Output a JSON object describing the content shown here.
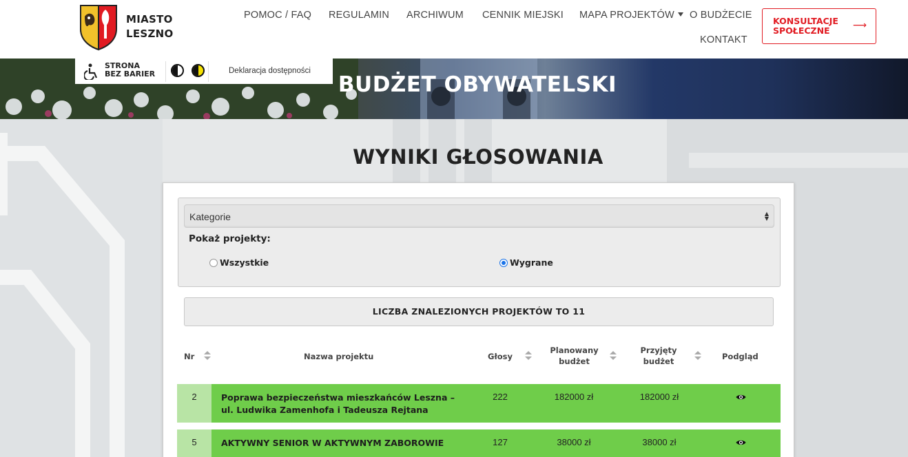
{
  "brand": {
    "name": "MIASTO\nLESZNO"
  },
  "nav": {
    "items": [
      "POMOC / FAQ",
      "REGULAMIN",
      "ARCHIWUM",
      "CENNIK MIEJSKI",
      "MAPA PROJEKTÓW",
      "O BUDŻECIE",
      "KONTAKT"
    ],
    "consult_button": "KONSULTACJE\nSPOŁECZNE"
  },
  "accessibility": {
    "label": "STRONA\nBEZ BARIER",
    "declaration": "Deklaracja dostępności"
  },
  "hero": {
    "title": "BUDŻET OBYWATELSKI"
  },
  "section": {
    "title": "WYNIKI GŁOSOWANIA"
  },
  "filters": {
    "category_select": "Kategorie",
    "show_label": "Pokaż projekty:",
    "radio_all": "Wszystkie",
    "radio_won": "Wygrane",
    "selected": "Wygrane"
  },
  "results": {
    "count_text": "LICZBA ZNALEZIONYCH PROJEKTÓW TO 11"
  },
  "table": {
    "headers": {
      "nr": "Nr",
      "name": "Nazwa projektu",
      "votes": "Głosy",
      "planned": "Planowany\nbudżet",
      "accepted": "Przyjęty\nbudżet",
      "preview": "Podgląd"
    },
    "rows": [
      {
        "nr": "2",
        "name": "Poprawa bezpieczeństwa mieszkańców Leszna – ul. Ludwika Zamenhofa i Tadeusza Rejtana",
        "votes": "222",
        "planned": "182000 zł",
        "accepted": "182000 zł"
      },
      {
        "nr": "5",
        "name": "AKTYWNY SENIOR W AKTYWNYM ZABOROWIE",
        "votes": "127",
        "planned": "38000 zł",
        "accepted": "38000 zł"
      }
    ]
  },
  "colors": {
    "accent_red": "#e11b22",
    "row_green": "#6fcd4a",
    "nr_green": "#b8e4a5",
    "radio_blue": "#1a73e8"
  },
  "icons": [
    "city-crest-icon",
    "wheelchair-icon",
    "contrast-dark-icon",
    "contrast-yellow-icon",
    "arrow-right-icon",
    "chevron-down-icon",
    "sort-icon",
    "eye-icon",
    "select-arrows-icon"
  ]
}
